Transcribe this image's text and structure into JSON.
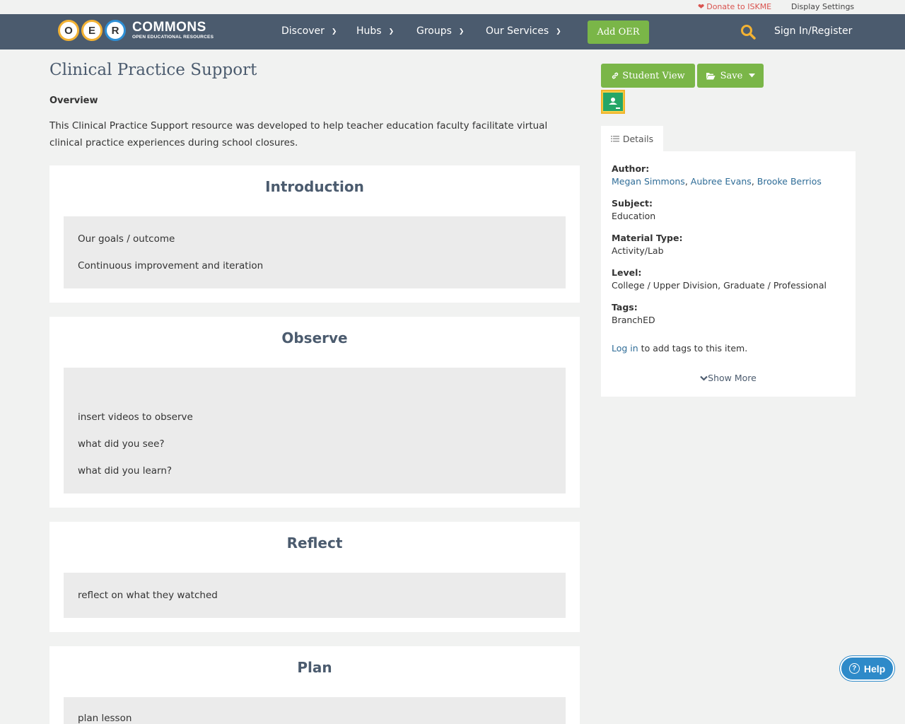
{
  "topbar": {
    "donate_label": "Donate to ISKME",
    "display_settings_label": "Display Settings"
  },
  "logo": {
    "letters": [
      "O",
      "E",
      "R"
    ],
    "wordmark": "COMMONS",
    "tagline": "OPEN EDUCATIONAL RESOURCES"
  },
  "nav": {
    "items": [
      {
        "label": "Discover"
      },
      {
        "label": "Hubs"
      },
      {
        "label": "Groups"
      },
      {
        "label": "Our Services"
      }
    ],
    "add_oer_label": "Add OER",
    "signin_label": "Sign In/Register"
  },
  "page": {
    "title": "Clinical Practice Support",
    "overview_heading": "Overview",
    "overview_text": "This Clinical Practice Support resource was developed to help teacher education faculty facilitate virtual clinical practice experiences during school closures."
  },
  "sections": [
    {
      "heading": "Introduction",
      "lines": [
        "Our goals / outcome",
        "Continuous improvement and iteration"
      ]
    },
    {
      "heading": "Observe",
      "lines": [
        "insert videos to observe",
        "what did you see?",
        "what did you learn?"
      ]
    },
    {
      "heading": "Reflect",
      "lines": [
        "reflect on what they watched"
      ]
    },
    {
      "heading": "Plan",
      "lines": [
        "plan lesson"
      ]
    }
  ],
  "sidebar": {
    "student_view_label": "Student View",
    "save_label": "Save",
    "details_tab_label": "Details",
    "author_key": "Author:",
    "authors": [
      "Megan Simmons",
      "Aubree Evans",
      "Brooke Berrios"
    ],
    "author_separator": ",",
    "subject_key": "Subject:",
    "subject_value": "Education",
    "material_key": "Material Type:",
    "material_value": "Activity/Lab",
    "level_key": "Level:",
    "level_value": "College / Upper Division, Graduate / Professional",
    "tags_key": "Tags:",
    "tags_value": "BranchED",
    "login_link": "Log in",
    "login_suffix": " to add tags to this item.",
    "show_more_label": "Show More"
  },
  "help_label": "Help",
  "colors": {
    "navbar": "#4b5b6e",
    "accent_green": "#7ab648",
    "link": "#2e6c97",
    "donate_red": "#d9534f",
    "help_blue": "#2e8ac9"
  }
}
